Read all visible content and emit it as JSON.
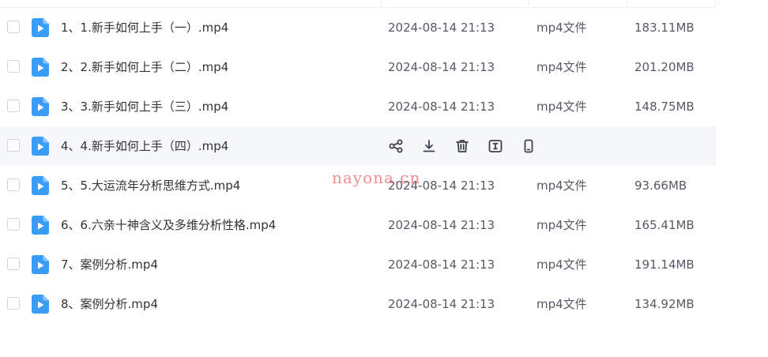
{
  "files": [
    {
      "name": "1、1.新手如何上手（一）.mp4",
      "date": "2024-08-14 21:13",
      "type": "mp4文件",
      "size": "183.11MB"
    },
    {
      "name": "2、2.新手如何上手（二）.mp4",
      "date": "2024-08-14 21:13",
      "type": "mp4文件",
      "size": "201.20MB"
    },
    {
      "name": "3、3.新手如何上手（三）.mp4",
      "date": "2024-08-14 21:13",
      "type": "mp4文件",
      "size": "148.75MB"
    },
    {
      "name": "4、4.新手如何上手（四）.mp4"
    },
    {
      "name": "5、5.大运流年分析思维方式.mp4",
      "date": "2024-08-14 21:13",
      "type": "mp4文件",
      "size": "93.66MB"
    },
    {
      "name": "6、6.六亲十神含义及多维分析性格.mp4",
      "date": "2024-08-14 21:13",
      "type": "mp4文件",
      "size": "165.41MB"
    },
    {
      "name": "7、案例分析.mp4",
      "date": "2024-08-14 21:13",
      "type": "mp4文件",
      "size": "191.14MB"
    },
    {
      "name": "8、案例分析.mp4",
      "date": "2024-08-14 21:13",
      "type": "mp4文件",
      "size": "134.92MB"
    }
  ],
  "hover_actions": [
    "share-icon",
    "download-icon",
    "delete-icon",
    "rename-icon",
    "phone-icon"
  ],
  "watermark": "nayona.cn",
  "colors": {
    "video_icon": "#3b9cf5",
    "hover_row": "#f5f7fb",
    "watermark": "#e85050"
  }
}
